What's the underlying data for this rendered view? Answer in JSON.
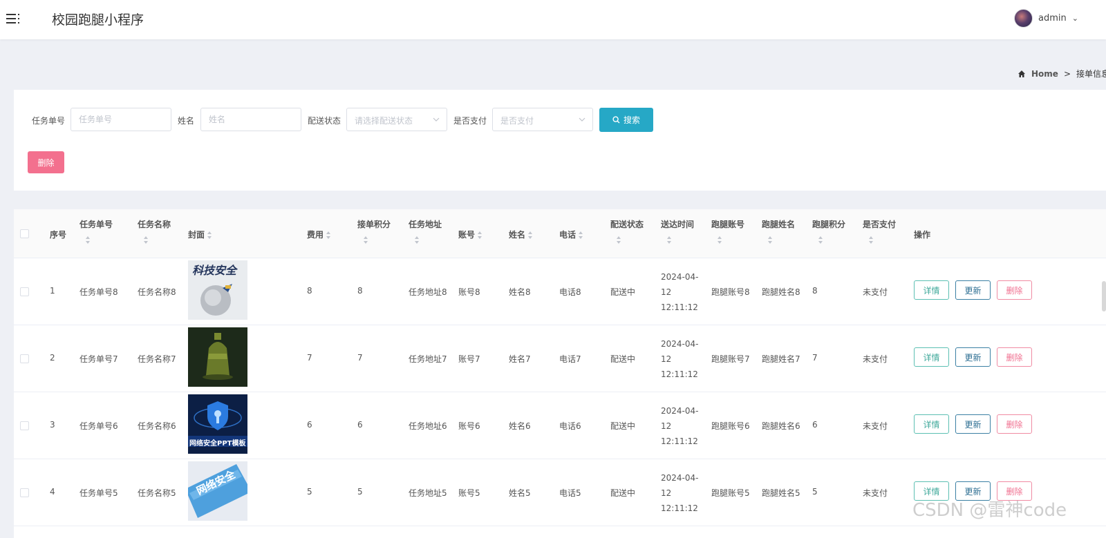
{
  "header": {
    "app_title": "校园跑腿小程序",
    "username": "admin"
  },
  "breadcrumb": {
    "home": "Home",
    "separator": ">",
    "current": "接单信息"
  },
  "search": {
    "task_no_label": "任务单号",
    "task_no_placeholder": "任务单号",
    "name_label": "姓名",
    "name_placeholder": "姓名",
    "status_label": "配送状态",
    "status_placeholder": "请选择配送状态",
    "paid_label": "是否支付",
    "paid_placeholder": "是否支付",
    "search_button": "搜索",
    "delete_button": "删除"
  },
  "table": {
    "headers": {
      "index": "序号",
      "task_no": "任务单号",
      "task_name": "任务名称",
      "cover": "封面",
      "fee": "费用",
      "points": "接单积分",
      "address": "任务地址",
      "account": "账号",
      "name": "姓名",
      "phone": "电话",
      "status": "配送状态",
      "time": "送达时间",
      "runner_account": "跑腿账号",
      "runner_name": "跑腿姓名",
      "runner_points": "跑腿积分",
      "paid": "是否支付",
      "actions": "操作"
    },
    "rows": [
      {
        "index": "1",
        "task_no": "任务单号8",
        "task_name": "任务名称8",
        "fee": "8",
        "points": "8",
        "address": "任务地址8",
        "account": "账号8",
        "name": "姓名8",
        "phone": "电话8",
        "status": "配送中",
        "time": "2024-04-12 12:11:12",
        "runner_account": "跑腿账号8",
        "runner_name": "跑腿姓名8",
        "runner_points": "8",
        "paid": "未支付",
        "cover_text": "科技安全"
      },
      {
        "index": "2",
        "task_no": "任务单号7",
        "task_name": "任务名称7",
        "fee": "7",
        "points": "7",
        "address": "任务地址7",
        "account": "账号7",
        "name": "姓名7",
        "phone": "电话7",
        "status": "配送中",
        "time": "2024-04-12 12:11:12",
        "runner_account": "跑腿账号7",
        "runner_name": "跑腿姓名7",
        "runner_points": "7",
        "paid": "未支付",
        "cover_text": ""
      },
      {
        "index": "3",
        "task_no": "任务单号6",
        "task_name": "任务名称6",
        "fee": "6",
        "points": "6",
        "address": "任务地址6",
        "account": "账号6",
        "name": "姓名6",
        "phone": "电话6",
        "status": "配送中",
        "time": "2024-04-12 12:11:12",
        "runner_account": "跑腿账号6",
        "runner_name": "跑腿姓名6",
        "runner_points": "6",
        "paid": "未支付",
        "cover_text": "网络安全PPT模板"
      },
      {
        "index": "4",
        "task_no": "任务单号5",
        "task_name": "任务名称5",
        "fee": "5",
        "points": "5",
        "address": "任务地址5",
        "account": "账号5",
        "name": "姓名5",
        "phone": "电话5",
        "status": "配送中",
        "time": "2024-04-12 12:11:12",
        "runner_account": "跑腿账号5",
        "runner_name": "跑腿姓名5",
        "runner_points": "5",
        "paid": "未支付",
        "cover_text": "网络安全"
      }
    ],
    "action_labels": {
      "detail": "详情",
      "update": "更新",
      "delete": "删除"
    }
  },
  "watermark": "CSDN @雷神code",
  "icons": {
    "menu": "menu-icon",
    "home": "home-icon",
    "search": "search-icon",
    "dropdown": "chevron-down-icon",
    "sort": "sort-icon"
  },
  "colors": {
    "search_button": "#26a8c6",
    "delete_button": "#f3708e",
    "detail": "#40a99b",
    "update": "#2e6f93",
    "remove": "#f07090"
  }
}
